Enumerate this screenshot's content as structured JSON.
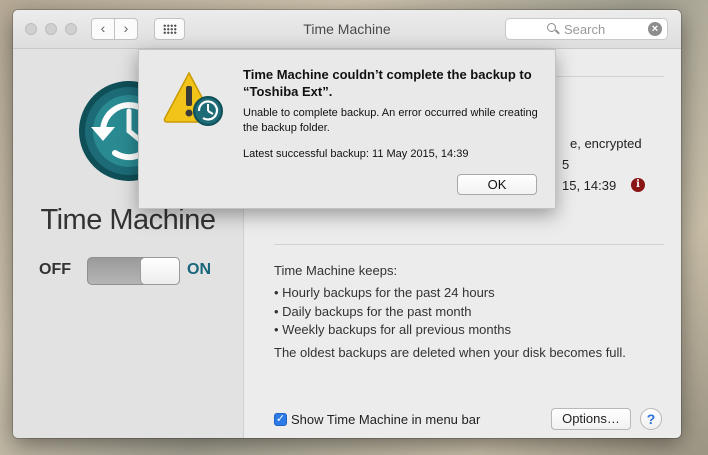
{
  "window": {
    "title": "Time Machine",
    "nav_back_symbol": "‹",
    "nav_forward_symbol": "›"
  },
  "search": {
    "placeholder": "Search",
    "value": "",
    "clear_symbol": "×"
  },
  "sidebar": {
    "app_name": "Time Machine",
    "toggle": {
      "off_label": "OFF",
      "on_label": "ON",
      "state": "on"
    }
  },
  "main": {
    "info_fragments": [
      "e, encrypted",
      "5",
      "15, 14:39"
    ],
    "info_badge": "i",
    "keeps_heading": "Time Machine keeps:",
    "keeps_items": [
      "Hourly backups for the past 24 hours",
      "Daily backups for the past month",
      "Weekly backups for all previous months"
    ],
    "oldest_note": "The oldest backups are deleted when your disk becomes full.",
    "menu_bar_checkbox": {
      "label": "Show Time Machine in menu bar",
      "checked": true,
      "check_symbol": "✓"
    },
    "options_label": "Options…",
    "help_label": "?"
  },
  "alert": {
    "title": "Time Machine couldn’t complete the backup to “Toshiba Ext”.",
    "message": "Unable to complete backup. An error occurred while creating the backup folder.",
    "last_backup": "Latest successful backup: 11 May 2015, 14:39",
    "ok_label": "OK"
  },
  "colors": {
    "accent_on": "#19667a",
    "checkbox_blue": "#2b7ae6",
    "warning_yellow": "#f2c318",
    "error_badge": "#8a1515",
    "logo_teal": "#1c6b77"
  }
}
